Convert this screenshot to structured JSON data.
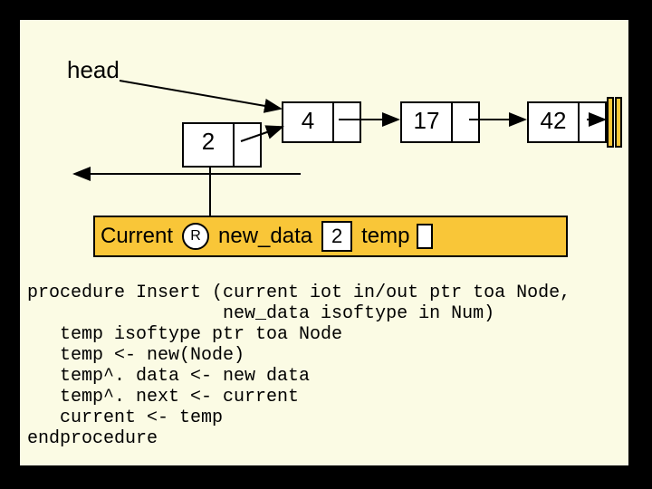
{
  "diagram": {
    "head_label": "head",
    "nodes": {
      "n0": "2",
      "n1": "4",
      "n2": "17",
      "n3": "42"
    },
    "current_row": {
      "current_label": "Current",
      "r_mark": "R",
      "new_data_label": "new_data",
      "new_data_value": "2",
      "temp_label": "temp"
    }
  },
  "code": "procedure Insert (current iot in/out ptr toa Node,\n                  new_data isoftype in Num)\n   temp isoftype ptr toa Node\n   temp <- new(Node)\n   temp^. data <- new data\n   temp^. next <- current\n   current <- temp\nendprocedure"
}
